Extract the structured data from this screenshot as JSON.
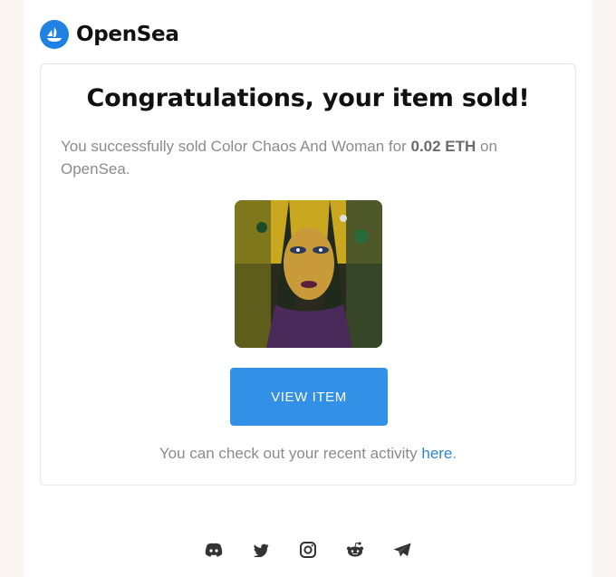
{
  "brand": {
    "name": "OpenSea",
    "accent": "#2081e2"
  },
  "email": {
    "title": "Congratulations, your item sold!",
    "message_prefix": "You successfully sold Color Chaos And Woman for ",
    "amount": "0.02 ETH",
    "message_suffix": " on OpenSea.",
    "item_image_icon": "nft-portrait-image",
    "button_label": "VIEW ITEM",
    "activity_prefix": "You can check out your recent activity ",
    "activity_link": "here",
    "activity_suffix": "."
  },
  "footer": {
    "social_icons": [
      "discord-icon",
      "twitter-icon",
      "instagram-icon",
      "reddit-icon",
      "telegram-icon"
    ]
  }
}
